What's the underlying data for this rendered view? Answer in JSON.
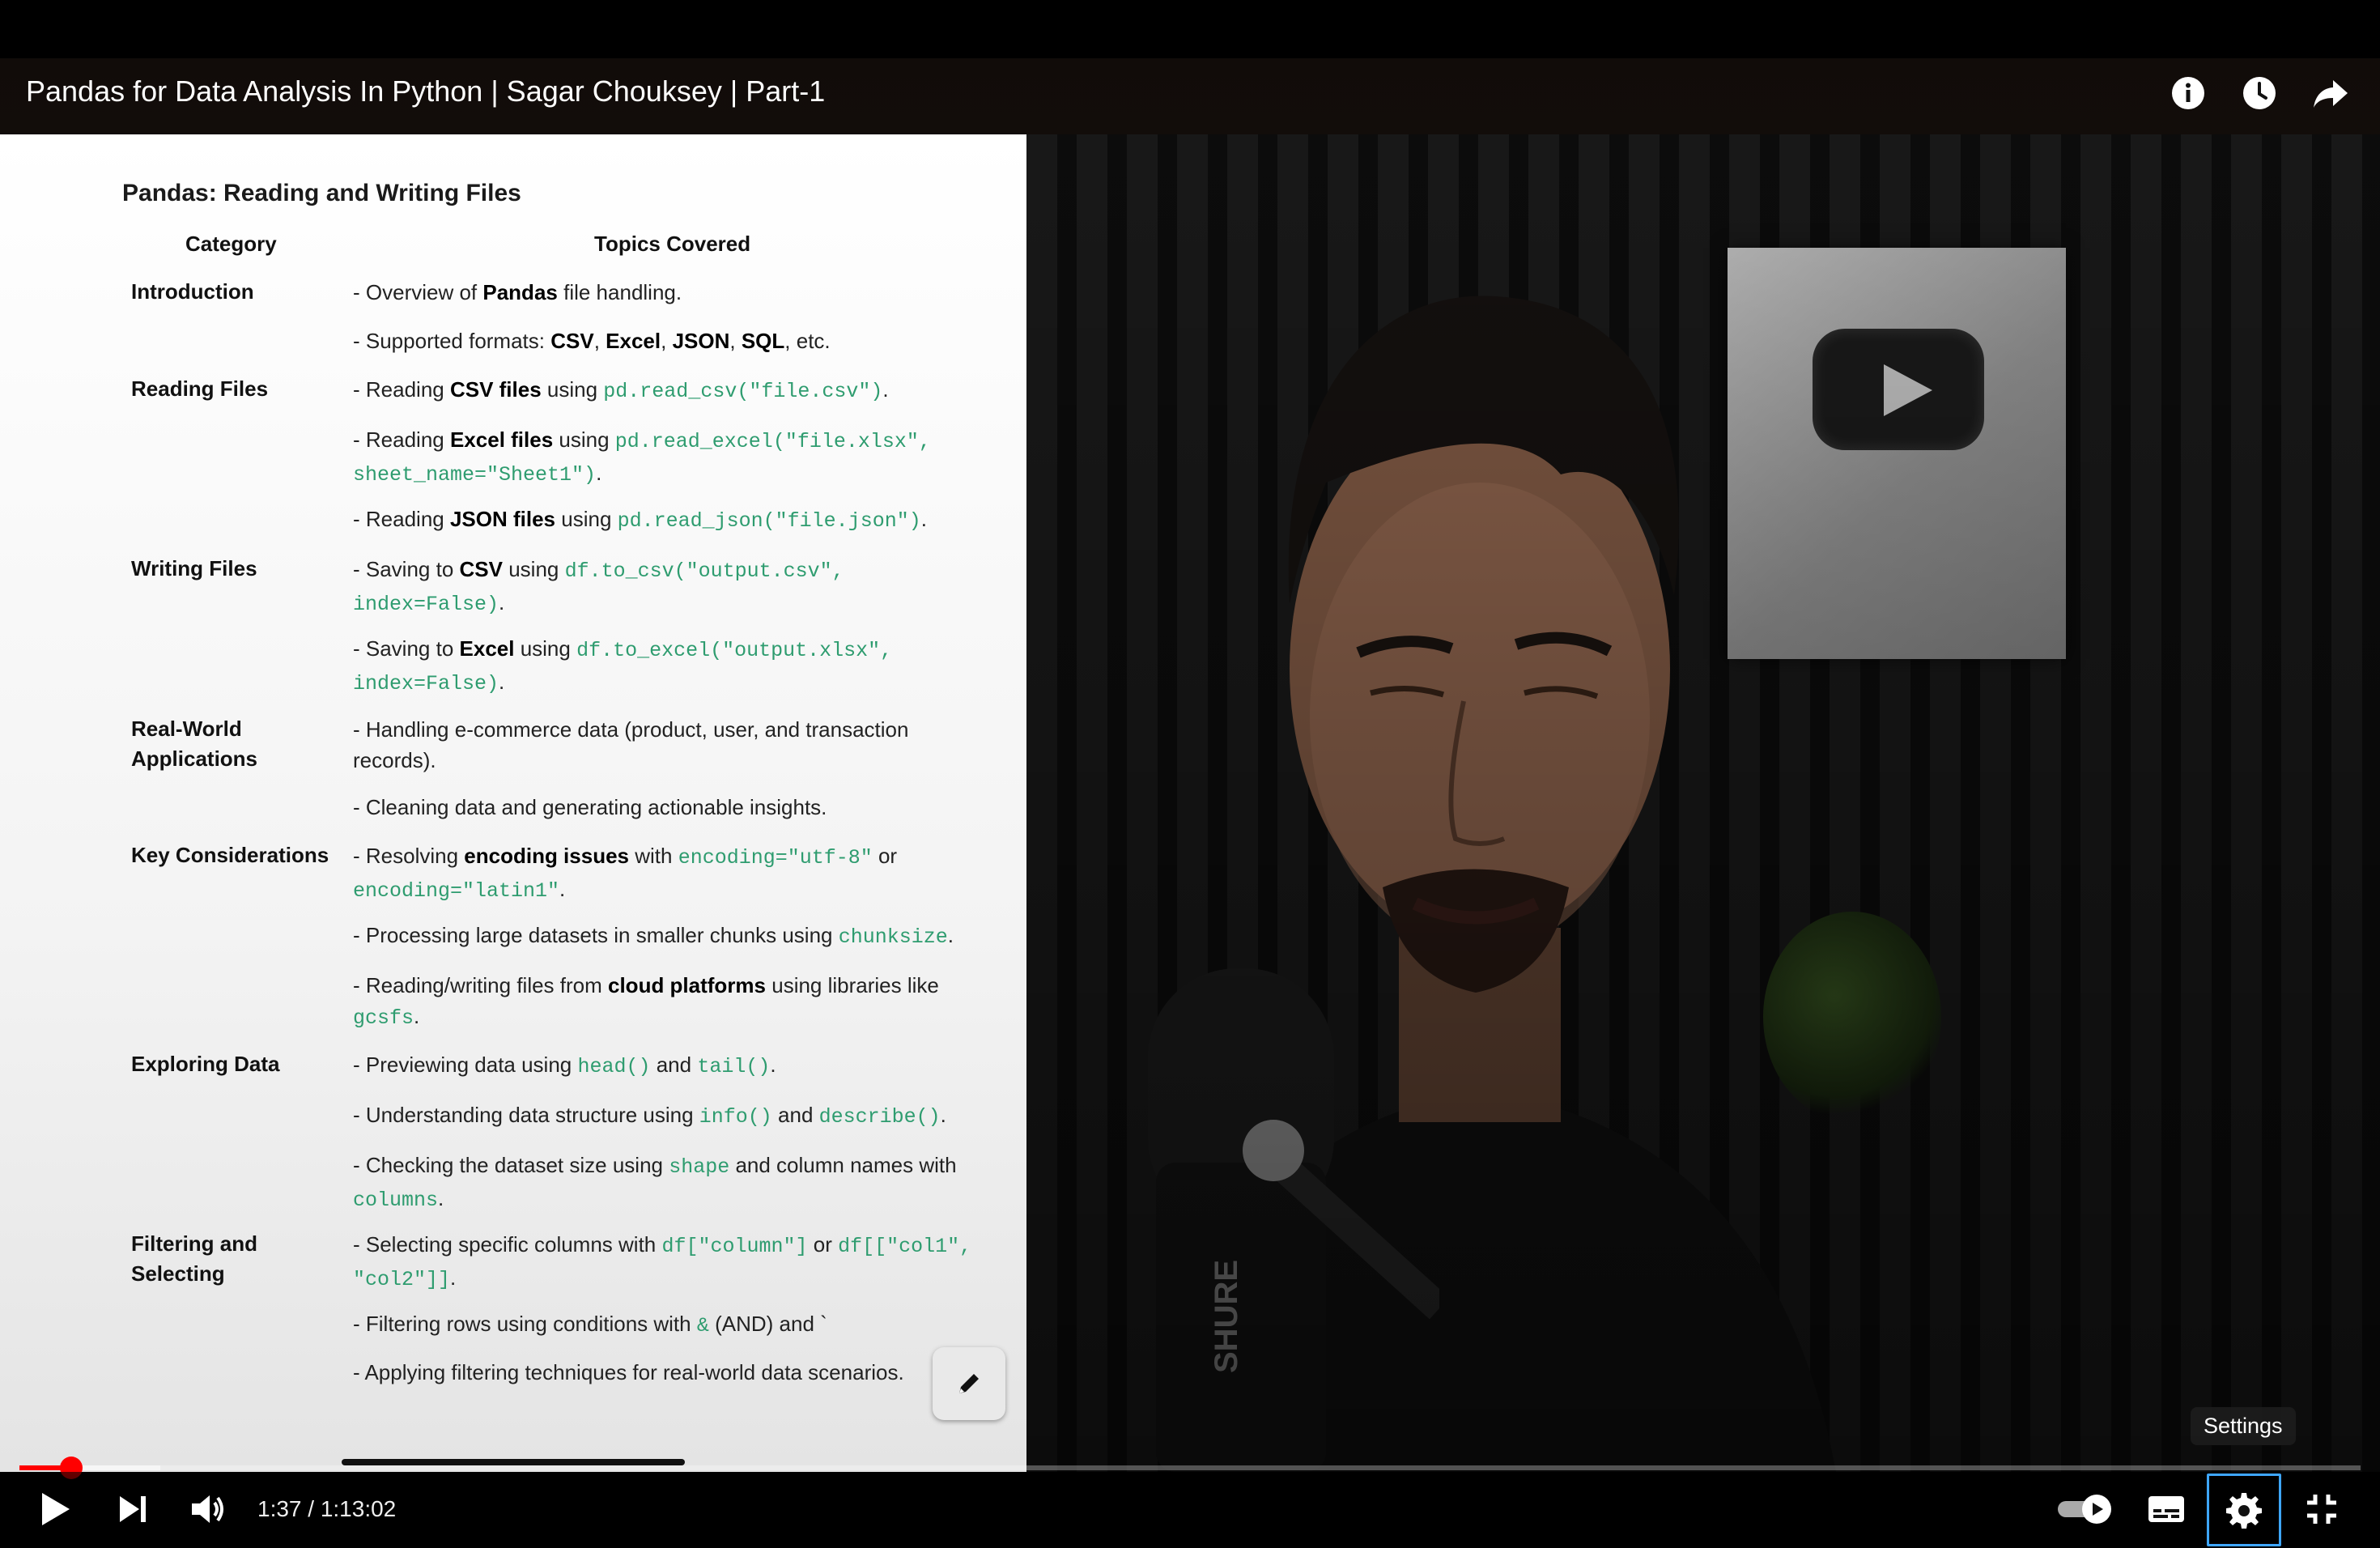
{
  "player": {
    "title": "Pandas for Data Analysis In Python | Sagar Chouksey | Part-1",
    "time_display": "1:37 / 1:13:02",
    "progress_fraction": 0.022,
    "buffered_fraction": 0.06,
    "tooltip": "Settings",
    "colors": {
      "progress": "#ff0000",
      "focus": "#3ea6ff"
    }
  },
  "top_icons": [
    "info-icon",
    "watch-later-icon",
    "share-icon"
  ],
  "controls": [
    "play-icon",
    "next-icon",
    "volume-icon",
    "autoplay-toggle",
    "subtitles-icon",
    "settings-icon",
    "exit-fullscreen-icon"
  ],
  "slide": {
    "title": "Pandas: Reading and Writing Files",
    "col_category": "Category",
    "col_topics": "Topics Covered",
    "categories": {
      "introduction": "Introduction",
      "reading": "Reading Files",
      "writing": "Writing Files",
      "realworld_1": "Real-World",
      "realworld_2": "Applications",
      "key": "Key Considerations",
      "exploring": "Exploring Data",
      "filtering_1": "Filtering and",
      "filtering_2": "Selecting"
    },
    "t": {
      "i1a": "- Overview of ",
      "i1b": "Pandas",
      "i1c": " file handling.",
      "i2a": "- Supported formats: ",
      "i2b": "CSV",
      "i2c": ", ",
      "i2d": "Excel",
      "i2e": ", ",
      "i2f": "JSON",
      "i2g": ", ",
      "i2h": "SQL",
      "i2i": ", etc.",
      "r1a": "- Reading ",
      "r1b": "CSV files",
      "r1c": " using ",
      "r1d": "pd.read_csv(\"file.csv\")",
      "r1e": ".",
      "r2a": "- Reading ",
      "r2b": "Excel files",
      "r2c": " using ",
      "r2d": "pd.read_excel(\"file.xlsx\",",
      "r2e": "sheet_name=\"Sheet1\")",
      "r2f": ".",
      "r3a": "- Reading ",
      "r3b": "JSON files",
      "r3c": " using ",
      "r3d": "pd.read_json(\"file.json\")",
      "r3e": ".",
      "w1a": "- Saving to ",
      "w1b": "CSV",
      "w1c": " using ",
      "w1d": "df.to_csv(\"output.csv\",",
      "w1e": "index=False)",
      "w1f": ".",
      "w2a": "- Saving to ",
      "w2b": "Excel",
      "w2c": " using ",
      "w2d": "df.to_excel(\"output.xlsx\",",
      "w2e": "index=False)",
      "w2f": ".",
      "a1": "- Handling e-commerce data (product, user, and transaction records).",
      "a2": "- Cleaning data and generating actionable insights.",
      "k1a": "- Resolving ",
      "k1b": "encoding issues",
      "k1c": " with ",
      "k1d": "encoding=\"utf-8\"",
      "k1e": " or",
      "k1f": "encoding=\"latin1\"",
      "k1g": ".",
      "k2a": "- Processing large datasets in smaller chunks using ",
      "k2b": "chunksize",
      "k2c": ".",
      "k3a": "- Reading/writing files from ",
      "k3b": "cloud platforms",
      "k3c": " using libraries like",
      "k3d": "gcsfs",
      "k3e": ".",
      "e1a": "- Previewing data using ",
      "e1b": "head()",
      "e1c": " and ",
      "e1d": "tail()",
      "e1e": ".",
      "e2a": "- Understanding data structure using ",
      "e2b": "info()",
      "e2c": " and ",
      "e2d": "describe()",
      "e2e": ".",
      "e3a": "- Checking the dataset size using ",
      "e3b": "shape",
      "e3c": " and column names with",
      "e3d": "columns",
      "e3e": ".",
      "f1a": "- Selecting specific columns with ",
      "f1b": "df[\"column\"]",
      "f1c": " or ",
      "f1d": "df[[\"col1\",",
      "f1e": "\"col2\"]]",
      "f1f": ".",
      "f2a": "- Filtering rows using conditions with ",
      "f2b": "&",
      "f2c": " (AND) and `",
      "f3": "- Applying filtering techniques for real-world data scenarios."
    }
  }
}
